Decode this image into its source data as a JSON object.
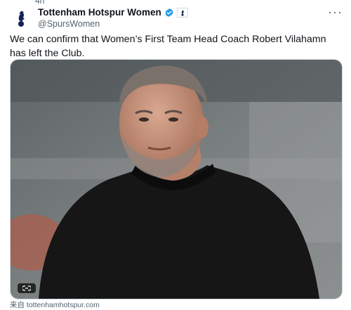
{
  "account": {
    "display_name": "Tottenham Hotspur Women",
    "handle": "@SpursWomen",
    "verified_color": "#1d9bf0",
    "affiliate_icon": "spurs-crest-badge",
    "avatar_icon": "spurs-cockerel-logo"
  },
  "header_cut_text": "4h",
  "more_label": "···",
  "tweet": {
    "text": "We can confirm that Women’s First Team Head Coach Robert Vilahamn has left the Club."
  },
  "media": {
    "link_icon": "link-icon"
  },
  "source": {
    "text": "来自 tottenhamhotspur.com"
  }
}
